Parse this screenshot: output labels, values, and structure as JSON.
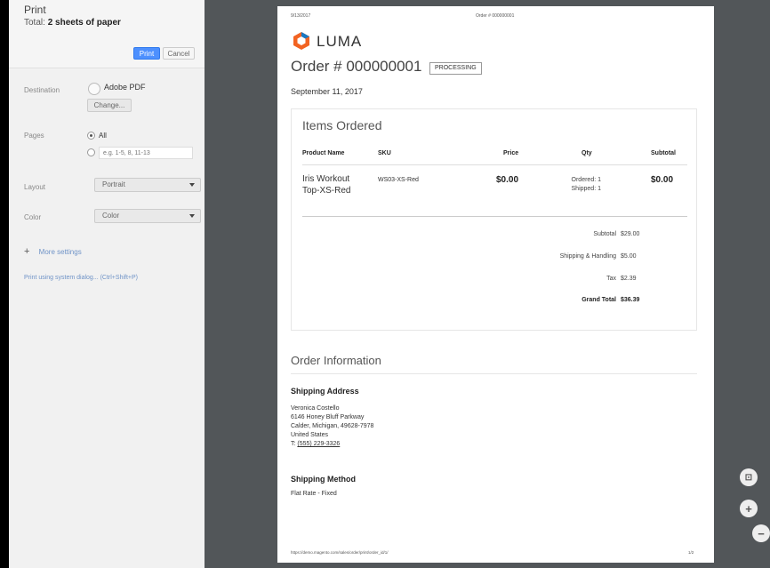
{
  "panel": {
    "title": "Print",
    "total_prefix": "Total:",
    "total_value": "2 sheets of paper",
    "print_label": "Print",
    "cancel_label": "Cancel",
    "destination_label": "Destination",
    "destination_value": "Adobe PDF",
    "change_label": "Change...",
    "pages_label": "Pages",
    "pages_all": "All",
    "pages_placeholder": "e.g. 1-5, 8, 11-13",
    "layout_label": "Layout",
    "layout_value": "Portrait",
    "color_label": "Color",
    "color_value": "Color",
    "more_settings": "More settings",
    "system_dialog": "Print using system dialog... (Ctrl+Shift+P)"
  },
  "page": {
    "header_date": "9/13/2017",
    "header_order": "Order # 000000001",
    "logo_text": "LUMA",
    "order_title": "Order # 000000001",
    "status": "PROCESSING",
    "order_date": "September 11, 2017",
    "items_title": "Items Ordered",
    "columns": {
      "product": "Product Name",
      "sku": "SKU",
      "price": "Price",
      "qty": "Qty",
      "subtotal": "Subtotal"
    },
    "item": {
      "name_line1": "Iris Workout",
      "name_line2": "Top-XS-Red",
      "sku": "WS03-XS-Red",
      "price": "$0.00",
      "qty_ordered": "Ordered: 1",
      "qty_shipped": "Shipped: 1",
      "subtotal": "$0.00"
    },
    "totals": {
      "subtotal_label": "Subtotal",
      "subtotal_value": "$29.00",
      "shipping_label": "Shipping & Handling",
      "shipping_value": "$5.00",
      "tax_label": "Tax",
      "tax_value": "$2.39",
      "grand_label": "Grand Total",
      "grand_value": "$36.39"
    },
    "order_info_title": "Order Information",
    "shipping_address_title": "Shipping Address",
    "address": {
      "name": "Veronica Costello",
      "street": "6146 Honey Bluff Parkway",
      "city": "Calder, Michigan, 49628-7978",
      "country": "United States",
      "phone_prefix": "T:",
      "phone": "(555) 229-3326"
    },
    "shipping_method_title": "Shipping Method",
    "shipping_method": "Flat Rate - Fixed",
    "footer_url": "https://demo.magento.com/sales/order/print/order_id/1/",
    "footer_page": "1/2"
  },
  "zoom": {
    "fit_icon": "fit-page-icon",
    "zoom_in_icon": "zoom-in-icon",
    "zoom_out_icon": "zoom-out-icon"
  },
  "colors": {
    "accent": "#4d90fe",
    "link": "#6f93c7",
    "viewer_bg": "#525659",
    "panel_bg": "#f1f1f1"
  }
}
